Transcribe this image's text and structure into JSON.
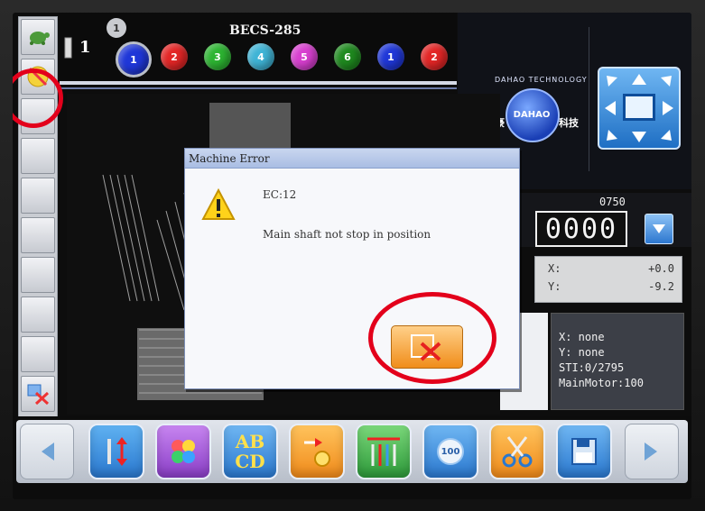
{
  "header": {
    "title": "BECS-285",
    "head_number": "1",
    "active_needle_badge": "1",
    "needles": [
      {
        "label": "1",
        "color": "#1f37d8"
      },
      {
        "label": "2",
        "color": "#e32626"
      },
      {
        "label": "3",
        "color": "#2db532"
      },
      {
        "label": "4",
        "color": "#3fb4d6"
      },
      {
        "label": "5",
        "color": "#d83fd0"
      },
      {
        "label": "6",
        "color": "#1f8a1f"
      },
      {
        "label": "1",
        "color": "#1f37d8"
      },
      {
        "label": "2",
        "color": "#e32626"
      }
    ]
  },
  "logo": {
    "arc_text": "DAHAO TECHNOLOGY",
    "badge": "DAHAO",
    "cn_left": "大豪",
    "cn_right": "科技"
  },
  "counter": {
    "main": "0000",
    "small": "0750"
  },
  "coords": {
    "x_label": "X:",
    "x_value": "+0.0",
    "y_label": "Y:",
    "y_value": "-9.2"
  },
  "status": {
    "x": "X: none",
    "y": "Y: none",
    "sti": "STI:0/2795",
    "motor": "MainMotor:100"
  },
  "dialog": {
    "title": "Machine Error",
    "code": "EC:12",
    "message": "Main shaft not stop in position"
  },
  "toolbar": {
    "abcd_line1": "AB",
    "abcd_line2": "CD",
    "counter_icon_text": "100"
  },
  "colors": {
    "annotation_red": "#e3001b",
    "dialog_close_orange": "#f08d1a",
    "toolbar_blue": "#2f86d8"
  }
}
